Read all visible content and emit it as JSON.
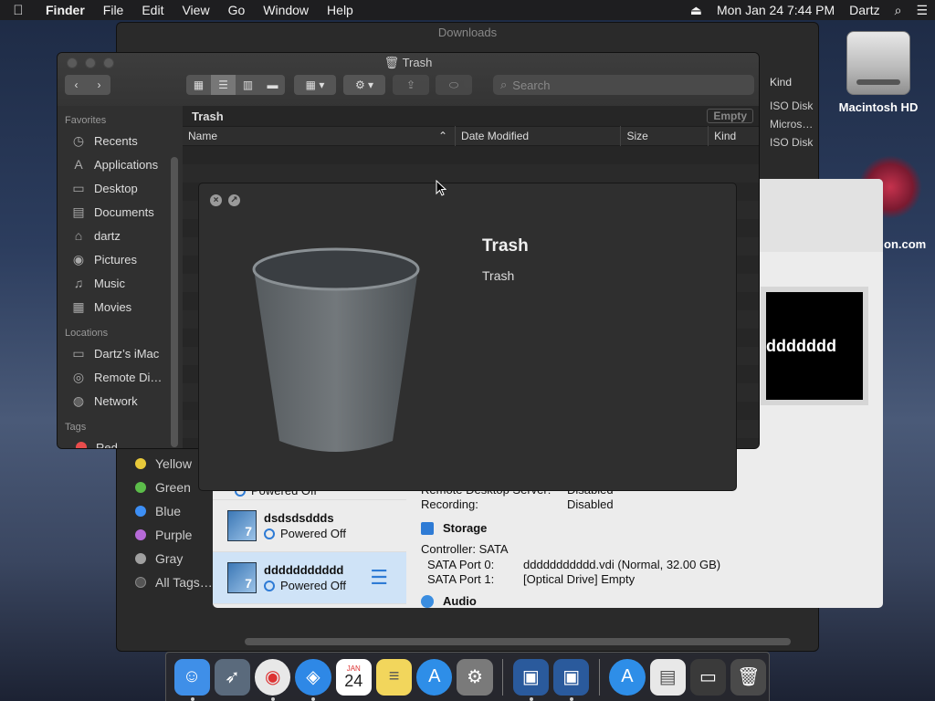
{
  "menubar": {
    "apple": "",
    "items": [
      "Finder",
      "File",
      "Edit",
      "View",
      "Go",
      "Window",
      "Help"
    ],
    "clock": "Mon Jan 24  7:44 PM",
    "user": "Dartz"
  },
  "desktop": {
    "hd_label": "Macintosh HD",
    "partial_label": "on.com"
  },
  "back_window": {
    "title": "Downloads",
    "kind_header": "Kind",
    "kinds": [
      "ISO Disk",
      "Micros…",
      "ISO Disk"
    ],
    "tags": [
      {
        "label": "Yellow",
        "color": "#e8c93a"
      },
      {
        "label": "Green",
        "color": "#5cbd4a"
      },
      {
        "label": "Blue",
        "color": "#3d8ff5"
      },
      {
        "label": "Purple",
        "color": "#b66ad8"
      },
      {
        "label": "Gray",
        "color": "#a0a0a0"
      },
      {
        "label": "All Tags…",
        "color": "#555555"
      }
    ]
  },
  "front_window": {
    "title": "Trash",
    "search_placeholder": "Search",
    "sidebar": {
      "favorites_header": "Favorites",
      "favorites": [
        {
          "label": "Recents",
          "icon": "clock-icon",
          "glyph": "◷"
        },
        {
          "label": "Applications",
          "icon": "applications-icon",
          "glyph": "A"
        },
        {
          "label": "Desktop",
          "icon": "desktop-icon",
          "glyph": "▭"
        },
        {
          "label": "Documents",
          "icon": "document-icon",
          "glyph": "▤"
        },
        {
          "label": "dartz",
          "icon": "home-icon",
          "glyph": "⌂"
        },
        {
          "label": "Pictures",
          "icon": "camera-icon",
          "glyph": "◉"
        },
        {
          "label": "Music",
          "icon": "music-icon",
          "glyph": "♫"
        },
        {
          "label": "Movies",
          "icon": "film-icon",
          "glyph": "▦"
        }
      ],
      "locations_header": "Locations",
      "locations": [
        {
          "label": "Dartz’s iMac",
          "icon": "computer-icon",
          "glyph": "▭"
        },
        {
          "label": "Remote Di…",
          "icon": "disc-icon",
          "glyph": "◎"
        },
        {
          "label": "Network",
          "icon": "globe-icon",
          "glyph": "◍"
        }
      ],
      "tags_header": "Tags",
      "first_tag": "Red"
    },
    "path_label": "Trash",
    "empty_button": "Empty",
    "columns": [
      "Name",
      "Date Modified",
      "Size",
      "Kind"
    ]
  },
  "quicklook": {
    "title": "Trash",
    "subtitle": "Trash"
  },
  "virtualbox": {
    "vms": [
      {
        "name": "",
        "state": "Powered Off"
      },
      {
        "name": "dsdsdsddds",
        "state": "Powered Off"
      },
      {
        "name": "ddddddddddd",
        "state": "Powered Off"
      }
    ],
    "logo_text": "7",
    "preview_text": "ddddddd",
    "rows": [
      {
        "k": "Remote Desktop Server:",
        "v": "Disabled"
      },
      {
        "k": "Recording:",
        "v": "Disabled"
      }
    ],
    "storage_header": "Storage",
    "controller": "Controller: SATA",
    "ports": [
      {
        "k": "SATA Port 0:",
        "v": "ddddddddddd.vdi (Normal, 32.00 GB)"
      },
      {
        "k": "SATA Port 1:",
        "v": "[Optical Drive] Empty"
      }
    ],
    "audio_header": "Audio"
  },
  "dock": {
    "calendar_month": "JAN",
    "calendar_day": "24",
    "apps": [
      {
        "name": "finder",
        "color": "#3f8fe8",
        "glyph": "☺"
      },
      {
        "name": "launchpad",
        "color": "#5a6a7c",
        "glyph": "🚀"
      },
      {
        "name": "chrome",
        "color": "#e8e8e8",
        "glyph": "◉"
      },
      {
        "name": "safari",
        "color": "#2e88e6",
        "glyph": "◈"
      },
      {
        "name": "calendar",
        "color": "#ffffff",
        "glyph": ""
      },
      {
        "name": "notes",
        "color": "#f2d65c",
        "glyph": "≡"
      },
      {
        "name": "app-store",
        "color": "#2e8ee8",
        "glyph": "A"
      },
      {
        "name": "system-preferences",
        "color": "#7a7a7a",
        "glyph": "⚙"
      },
      {
        "name": "virtualbox",
        "color": "#2a5a9c",
        "glyph": "▣"
      },
      {
        "name": "virtualbox-vm",
        "color": "#2a5a9c",
        "glyph": "▣"
      },
      {
        "name": "app-store-downloads",
        "color": "#2e8ee8",
        "glyph": "A"
      },
      {
        "name": "document",
        "color": "#e8e8e8",
        "glyph": "▤"
      },
      {
        "name": "chrome-window",
        "color": "#3a3a3a",
        "glyph": "▭"
      },
      {
        "name": "trash",
        "color": "#4a4a4a",
        "glyph": "🗑"
      }
    ]
  }
}
